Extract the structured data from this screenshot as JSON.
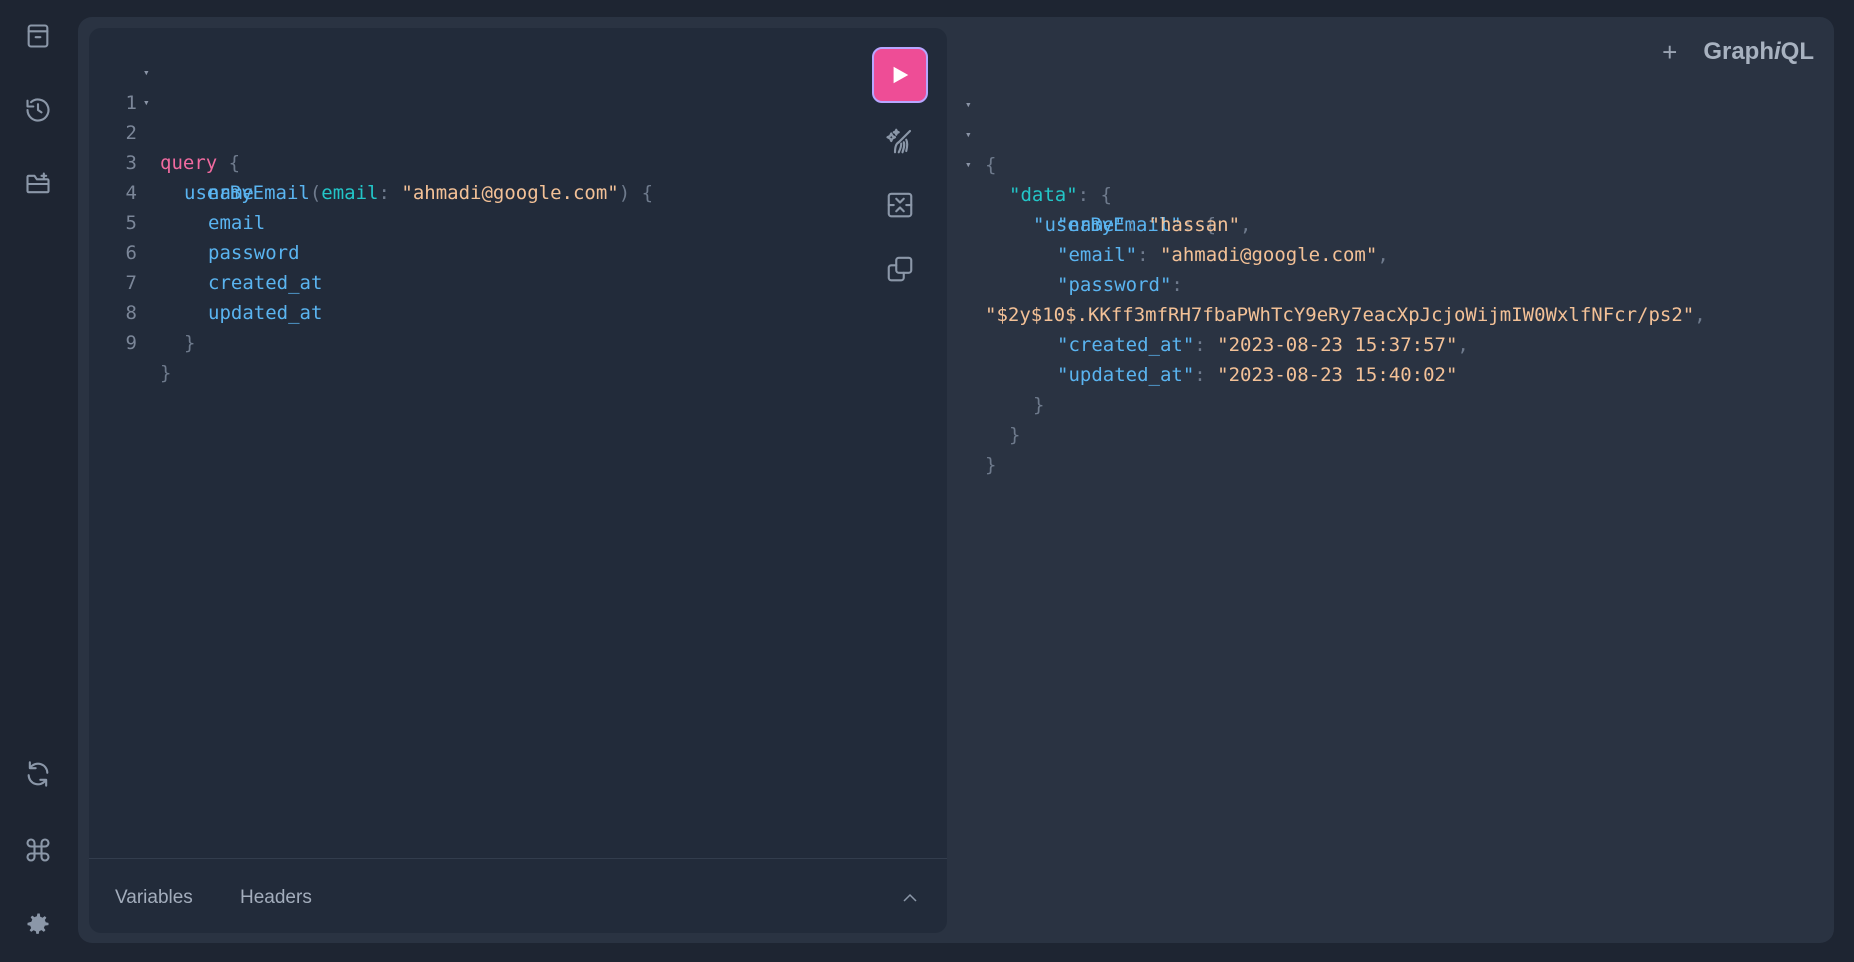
{
  "sidebar": {
    "top_icons": [
      "docs-icon",
      "history-icon",
      "add-folder-icon"
    ],
    "bottom_icons": [
      "refresh-icon",
      "shortcuts-icon",
      "settings-icon"
    ]
  },
  "header": {
    "plus_label": "+",
    "brand_prefix": "Graph",
    "brand_italic": "i",
    "brand_suffix": "QL"
  },
  "editor": {
    "lines": [
      {
        "n": "1",
        "kw": "query",
        "rest": " {"
      },
      {
        "n": "2",
        "fn": "userByEmail",
        "open": "(",
        "arg": "email",
        "colon": ": ",
        "str": "\"ahmadi@google.com\"",
        "close": ") {"
      },
      {
        "n": "3",
        "field": "name"
      },
      {
        "n": "4",
        "field": "email"
      },
      {
        "n": "5",
        "field": "password"
      },
      {
        "n": "6",
        "field": "created_at"
      },
      {
        "n": "7",
        "field": "updated_at"
      },
      {
        "n": "8",
        "punc": "}"
      },
      {
        "n": "9",
        "punc": "}"
      }
    ],
    "fold_glyph": "▾"
  },
  "bottom_tabs": {
    "variables": "Variables",
    "headers": "Headers"
  },
  "result": {
    "open_brace": "{",
    "data_key": "\"data\"",
    "user_key": "\"userByEmail\"",
    "name_key": "\"name\"",
    "name_val": "\"hassan\"",
    "email_key": "\"email\"",
    "email_val": "\"ahmadi@google.com\"",
    "password_key": "\"password\"",
    "password_val": "\"$2y$10$.KKff3mfRH7fbaPWhTcY9eRy7eacXpJcjoWijmIW0WxlfNFcr/ps2\"",
    "created_key": "\"created_at\"",
    "created_val": "\"2023-08-23 15:37:57\"",
    "updated_key": "\"updated_at\"",
    "updated_val": "\"2023-08-23 15:40:02\"",
    "close_brace": "}",
    "colon": ": ",
    "comma": ",",
    "open_obj": "{"
  },
  "colors": {
    "accent": "#ee4d96",
    "background": "#1e2532",
    "panel": "#2a3342",
    "editor": "#222b3a"
  }
}
